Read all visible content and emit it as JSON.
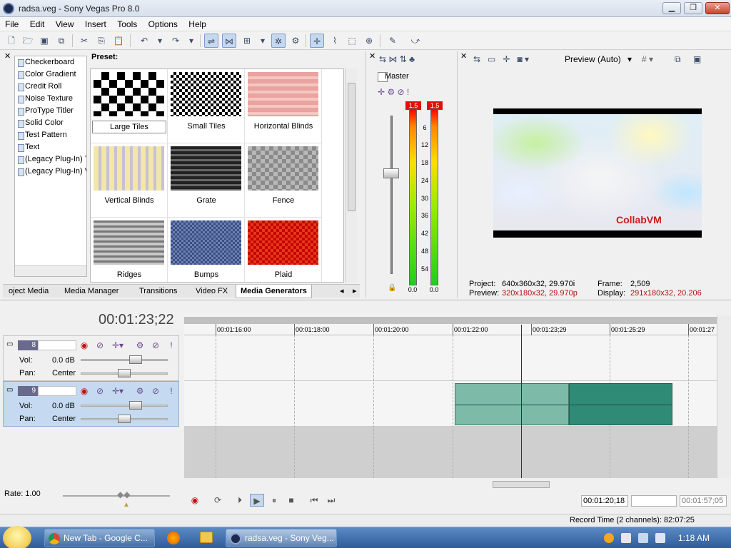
{
  "window": {
    "title": "radsa.veg - Sony Vegas Pro 8.0"
  },
  "menu": [
    "File",
    "Edit",
    "View",
    "Insert",
    "Tools",
    "Options",
    "Help"
  ],
  "generators": {
    "list": [
      "Checkerboard",
      "Color Gradient",
      "Credit Roll",
      "Noise Texture",
      "ProType Titler",
      "Solid Color",
      "Test Pattern",
      "Text",
      "(Legacy Plug-In) T",
      "(Legacy Plug-In) V"
    ],
    "preset_label": "Preset:",
    "presets": [
      "Large Tiles",
      "Small Tiles",
      "Horizontal Blinds",
      "Vertical Blinds",
      "Grate",
      "Fence",
      "Ridges",
      "Bumps",
      "Plaid"
    ]
  },
  "tabs": [
    "oject Media",
    "Media Manager",
    "Transitions",
    "Video FX",
    "Media Generators"
  ],
  "mixer": {
    "master_label": "Master",
    "peak_left": "1.5",
    "peak_right": "1.5",
    "ticks": [
      "6",
      "12",
      "18",
      "24",
      "30",
      "36",
      "42",
      "48",
      "54"
    ],
    "value_left": "0.0",
    "value_right": "0.0"
  },
  "preview": {
    "mode_label": "Preview (Auto)",
    "watermark": "CollabVM",
    "project_label": "Project:",
    "project_value": "640x360x32, 29.970i",
    "preview_label": "Preview:",
    "preview_value": "320x180x32, 29.970p",
    "frame_label": "Frame:",
    "frame_value": "2,509",
    "display_label": "Display:",
    "display_value": "291x180x32, 20.206"
  },
  "timeline": {
    "timecode": "00:01:23;22",
    "ruler": [
      "00:01:16:00",
      "00:01:18:00",
      "00:01:20:00",
      "00:01:22:00",
      "00:01:23;29",
      "00:01:25:29",
      "00:01:27"
    ],
    "tracks": [
      {
        "number": "8",
        "vol_label": "Vol:",
        "vol_value": "0.0 dB",
        "pan_label": "Pan:",
        "pan_value": "Center"
      },
      {
        "number": "9",
        "vol_label": "Vol:",
        "vol_value": "0.0 dB",
        "pan_label": "Pan:",
        "pan_value": "Center"
      }
    ]
  },
  "transport": {
    "rate_label": "Rate: 1.00",
    "tc_start": "00:01:20;18",
    "tc_end": "00:01:57;05"
  },
  "status": {
    "record_time": "Record Time (2 channels): 82:07:25"
  },
  "taskbar": {
    "items": [
      "New Tab - Google C...",
      "radsa.veg - Sony Veg..."
    ],
    "clock": "1:18 AM"
  },
  "colors": {
    "accent": "#2f8b76",
    "clip_light": "#7ebaa8",
    "meter_peak": "#e10f0f",
    "taskbar": "#2f5d9a"
  }
}
